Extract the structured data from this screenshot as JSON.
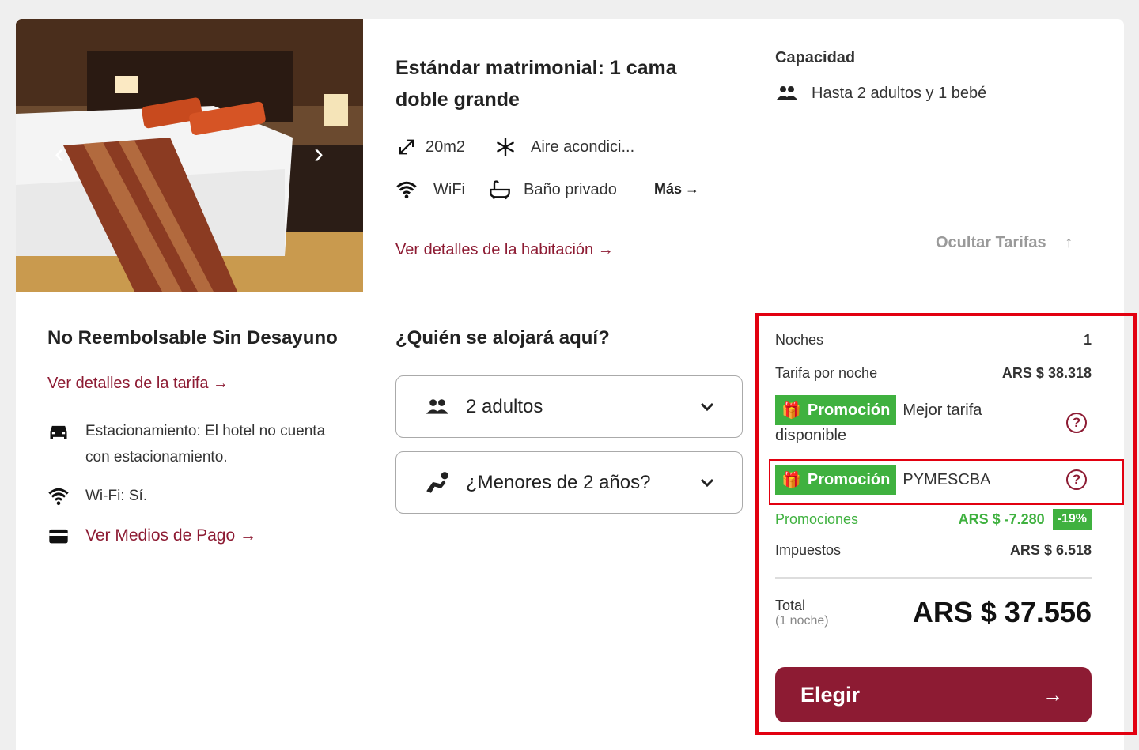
{
  "room": {
    "title": "Estándar matrimonial: 1 cama doble grande",
    "size": "20m2",
    "amenity_ac": "Aire acondici...",
    "amenity_wifi": "WiFi",
    "amenity_bath": "Baño privado",
    "more_label": "Más",
    "details_link": "Ver detalles de la habitación",
    "capacity_title": "Capacidad",
    "capacity_text": "Hasta 2 adultos y 1 bebé",
    "hide_rates": "Ocultar Tarifas"
  },
  "rate": {
    "title": "No Reembolsable Sin Desayuno",
    "details_link": "Ver detalles de la tarifa",
    "parking": "Estacionamiento: El hotel no cuenta con estacionamiento.",
    "wifi": "Wi-Fi: Sí.",
    "payment_link": "Ver Medios de Pago"
  },
  "guests": {
    "title": "¿Quién se alojará aquí?",
    "adults": "2 adultos",
    "children": "¿Menores de 2 años?"
  },
  "summary": {
    "nights_label": "Noches",
    "nights_value": "1",
    "rate_label": "Tarifa por noche",
    "rate_value": "ARS $ 38.318",
    "promo_badge": "Promoción",
    "promo1_text": "Mejor tarifa",
    "promo1_text2": "disponible",
    "promo2_text": "PYMESCBA",
    "promos_label": "Promociones",
    "promos_value": "ARS $ -7.280",
    "promos_pct": "-19%",
    "tax_label": "Impuestos",
    "tax_value": "ARS $ 6.518",
    "total_label": "Total",
    "total_sub": "(1 noche)",
    "total_value": "ARS $ 37.556",
    "choose_label": "Elegir"
  },
  "colors": {
    "accent": "#8d1b33",
    "promo": "#3fb13f",
    "highlight": "#e20010"
  },
  "icons": [
    "chevron-left-icon",
    "chevron-right-icon",
    "resize-icon",
    "snowflake-icon",
    "wifi-icon",
    "bathtub-icon",
    "people-icon",
    "car-icon",
    "card-icon",
    "gift-icon",
    "help-icon",
    "chevron-down-icon",
    "baby-icon",
    "arrow-right-icon"
  ]
}
